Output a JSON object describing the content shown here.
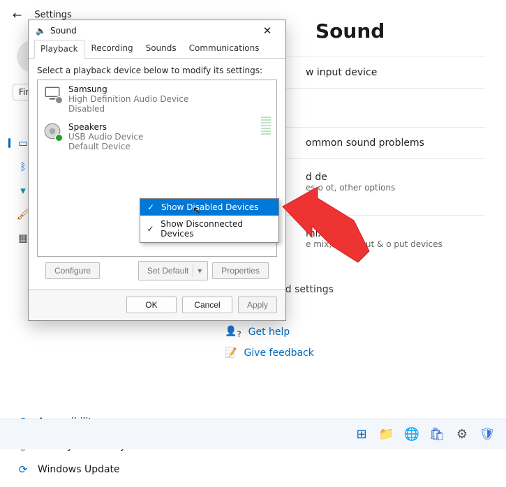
{
  "settings": {
    "back_icon": "←",
    "title": "Settings",
    "find_placeholder": "Fin",
    "selected_page": "Sound",
    "nav": [
      {
        "name": "system",
        "label": "",
        "icon": "▭",
        "color": "blue"
      },
      {
        "name": "bluetooth",
        "label": "",
        "icon": "ᛒ",
        "color": "blue"
      },
      {
        "name": "network",
        "label": "",
        "icon": "📶",
        "color": "aqua"
      },
      {
        "name": "personalization",
        "label": "",
        "icon": "🖌",
        "color": "orange"
      },
      {
        "name": "apps",
        "label": "",
        "icon": "▦",
        "color": "gray"
      }
    ],
    "nav_named": [
      {
        "name": "accessibility",
        "label": "Accessibility",
        "icon": "⚲",
        "color": "blue"
      },
      {
        "name": "privacy",
        "label": "Privacy & security",
        "icon": "🛡",
        "color": "gray"
      },
      {
        "name": "windows-update",
        "label": "Windows Update",
        "icon": "⟳",
        "color": "blue"
      }
    ]
  },
  "sound_page": {
    "title": "Sound",
    "row1": "w input device",
    "row2_title": "ommon sound problems",
    "row3_title": "d de",
    "row3_sub": "es o                          ot, other options",
    "row4_title": "mixer",
    "row4_sub": "e mix, app input & o    put devices",
    "more": "More sound settings",
    "help": {
      "label": "Get help",
      "icon": "❔"
    },
    "feedback": {
      "label": "Give feedback",
      "icon": "📝"
    }
  },
  "dialog": {
    "title": "Sound",
    "close": "✕",
    "tabs": [
      "Playback",
      "Recording",
      "Sounds",
      "Communications"
    ],
    "active_tab": 0,
    "instruction": "Select a playback device below to modify its settings:",
    "devices": [
      {
        "name": "Samsung",
        "driver": "High Definition Audio Device",
        "status": "Disabled",
        "default": false
      },
      {
        "name": "Speakers",
        "driver": "USB Audio Device",
        "status": "Default Device",
        "default": true
      }
    ],
    "configure_btn": "Configure",
    "set_default_btn": "Set Default",
    "properties_btn": "Properties",
    "ok_btn": "OK",
    "cancel_btn": "Cancel",
    "apply_btn": "Apply"
  },
  "context_menu": {
    "items": [
      {
        "label": "Show Disabled Devices",
        "checked": true,
        "selected": true
      },
      {
        "label": "Show Disconnected Devices",
        "checked": true,
        "selected": false
      }
    ]
  },
  "taskbar": {
    "icons": [
      {
        "name": "start-icon",
        "glyph": "⊞",
        "color": "#0067c0"
      },
      {
        "name": "explorer-icon",
        "glyph": "📁",
        "color": "#f1c24a"
      },
      {
        "name": "edge-icon",
        "glyph": "🌐",
        "color": "#0b88d6"
      },
      {
        "name": "store-icon",
        "glyph": "🛍",
        "color": "#2262c9"
      },
      {
        "name": "settings-icon",
        "glyph": "⚙",
        "color": "#555"
      },
      {
        "name": "security-icon",
        "glyph": "🛡",
        "color": "#2f7bd9"
      }
    ]
  },
  "arrow_color": "#ee3333"
}
